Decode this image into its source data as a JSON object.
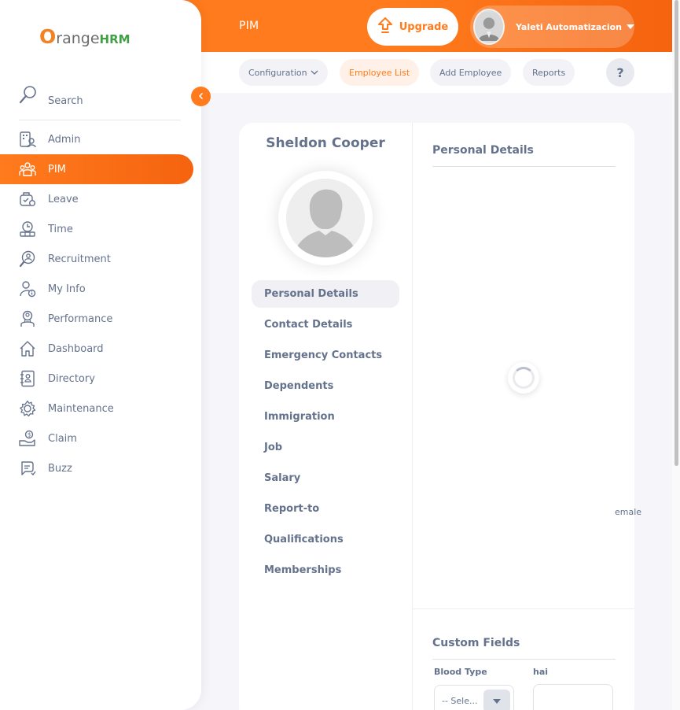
{
  "header": {
    "module_title": "PIM",
    "upgrade_label": "Upgrade",
    "user_name": "Yaleti Automatizacion"
  },
  "subnav": {
    "tabs": [
      {
        "label": "Configuration",
        "active": false,
        "has_dropdown": true
      },
      {
        "label": "Employee List",
        "active": true,
        "has_dropdown": false
      },
      {
        "label": "Add Employee",
        "active": false,
        "has_dropdown": false
      },
      {
        "label": "Reports",
        "active": false,
        "has_dropdown": false
      }
    ],
    "help_label": "?"
  },
  "sidebar": {
    "logo": {
      "o": "O",
      "rest": "range",
      "hrm": "HRM"
    },
    "search_label": "Search",
    "items": [
      {
        "label": "Admin",
        "icon": "admin-icon",
        "active": false
      },
      {
        "label": "PIM",
        "icon": "pim-icon",
        "active": true
      },
      {
        "label": "Leave",
        "icon": "leave-icon",
        "active": false
      },
      {
        "label": "Time",
        "icon": "time-icon",
        "active": false
      },
      {
        "label": "Recruitment",
        "icon": "recruitment-icon",
        "active": false
      },
      {
        "label": "My Info",
        "icon": "my-info-icon",
        "active": false
      },
      {
        "label": "Performance",
        "icon": "performance-icon",
        "active": false
      },
      {
        "label": "Dashboard",
        "icon": "dashboard-icon",
        "active": false
      },
      {
        "label": "Directory",
        "icon": "directory-icon",
        "active": false
      },
      {
        "label": "Maintenance",
        "icon": "maintenance-icon",
        "active": false
      },
      {
        "label": "Claim",
        "icon": "claim-icon",
        "active": false
      },
      {
        "label": "Buzz",
        "icon": "buzz-icon",
        "active": false
      }
    ]
  },
  "employee": {
    "name": "Sheldon Cooper",
    "tabs": [
      {
        "label": "Personal Details",
        "active": true
      },
      {
        "label": "Contact Details",
        "active": false
      },
      {
        "label": "Emergency Contacts",
        "active": false
      },
      {
        "label": "Dependents",
        "active": false
      },
      {
        "label": "Immigration",
        "active": false
      },
      {
        "label": "Job",
        "active": false
      },
      {
        "label": "Salary",
        "active": false
      },
      {
        "label": "Report-to",
        "active": false
      },
      {
        "label": "Qualifications",
        "active": false
      },
      {
        "label": "Memberships",
        "active": false
      }
    ]
  },
  "personal_details": {
    "title": "Personal Details",
    "partial_text": "emale"
  },
  "custom_fields": {
    "title": "Custom Fields",
    "blood_type_label": "Blood Type",
    "blood_type_value": "-- Sele...",
    "hai_label": "hai",
    "hai_value": ""
  },
  "colors": {
    "accent": "#ff7b1d",
    "text": "#64728c",
    "active_tab_bg": "#fff1e7"
  }
}
